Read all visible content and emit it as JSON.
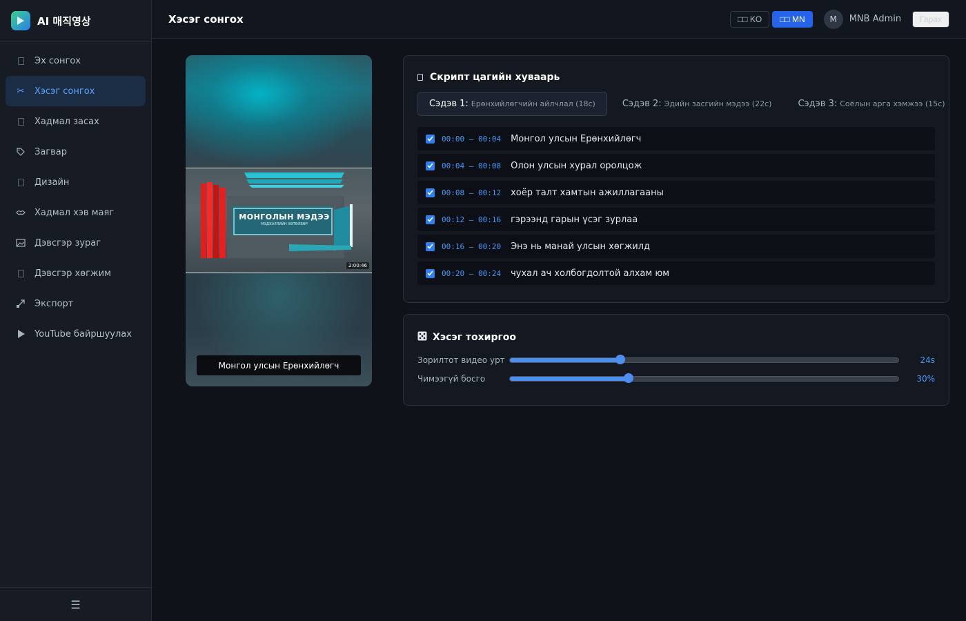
{
  "app": {
    "name": "AI 매직영상"
  },
  "sidebar": {
    "items": [
      {
        "label": "Эх сонгох",
        "icon": "file-icon",
        "active": false
      },
      {
        "label": "Хэсэг сонгох",
        "icon": "scissors-icon",
        "active": true
      },
      {
        "label": "Хадмал засах",
        "icon": "file-icon",
        "active": false
      },
      {
        "label": "Загвар",
        "icon": "tag-icon",
        "active": false
      },
      {
        "label": "Дизайн",
        "icon": "file-icon",
        "active": false
      },
      {
        "label": "Хадмал хэв маяг",
        "icon": "lips-icon",
        "active": false
      },
      {
        "label": "Дэвсгэр зураг",
        "icon": "image-icon",
        "active": false
      },
      {
        "label": "Дэвсгэр хөгжим",
        "icon": "file-icon",
        "active": false
      },
      {
        "label": "Экспорт",
        "icon": "export-icon",
        "active": false
      },
      {
        "label": "YouTube байршуулах",
        "icon": "play-icon",
        "active": false
      }
    ],
    "footer_icon": "☰"
  },
  "header": {
    "title": "Хэсэг сонгох",
    "lang_ko": "□□ KO",
    "lang_mn": "□□ MN",
    "active_lang": "MN",
    "avatar_initial": "M",
    "user_name": "MNB Admin",
    "logout_label": "Гарах"
  },
  "preview": {
    "frame_title": "МОНГОЛЫН МЭДЭЭ",
    "frame_subtitle": "МЭДЭЭЛЛИЙН ХӨТӨЛБӨР",
    "frame_time": "2:00:46",
    "caption": "Монгол улсын Ерөнхийлөгч"
  },
  "script": {
    "title": "Скрипт цагийн хуваарь",
    "tabs": [
      {
        "label": "Сэдэв 1:",
        "sub": "Ерөнхийлөгчийн айлчлал (18с)",
        "active": true
      },
      {
        "label": "Сэдэв 2:",
        "sub": "Эдийн засгийн мэдээ (22с)",
        "active": false
      },
      {
        "label": "Сэдэв 3:",
        "sub": "Соёлын арга хэмжээ (15с)",
        "active": false
      }
    ],
    "segments": [
      {
        "time": "00:00 – 00:04",
        "text": "Монгол улсын Ерөнхийлөгч",
        "checked": true
      },
      {
        "time": "00:04 – 00:08",
        "text": "Олон улсын хурал оролцож",
        "checked": true
      },
      {
        "time": "00:08 – 00:12",
        "text": "хоёр талт хамтын ажиллагааны",
        "checked": true
      },
      {
        "time": "00:12 – 00:16",
        "text": "гэрээнд гарын үсэг зурлаа",
        "checked": true
      },
      {
        "time": "00:16 – 00:20",
        "text": "Энэ нь манай улсын хөгжилд",
        "checked": true
      },
      {
        "time": "00:20 – 00:24",
        "text": "чухал ач холбогдолтой алхам юм",
        "checked": true
      }
    ]
  },
  "settings": {
    "title": "Хэсэг тохиргоо",
    "target_length": {
      "label": "Зорилтот видео урт",
      "value": "24s",
      "fraction": 0.285
    },
    "silence_cut": {
      "label": "Чимээгүй босго",
      "value": "30%",
      "fraction": 0.305
    }
  },
  "colors": {
    "accent": "#2f80ed",
    "active_nav_bg": "#1b2c45",
    "background": "#0f1218"
  }
}
